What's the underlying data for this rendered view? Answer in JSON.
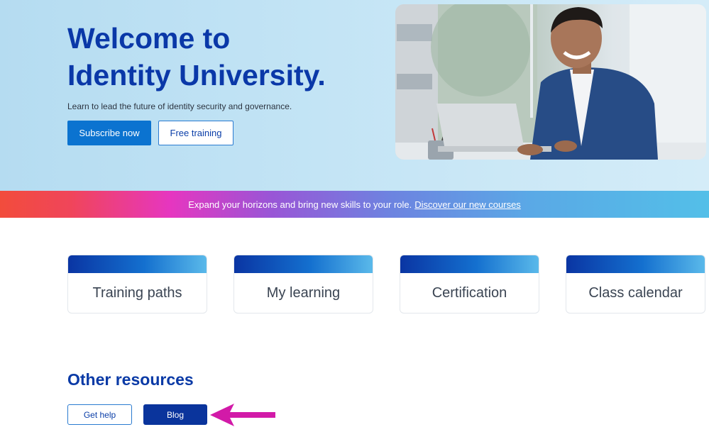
{
  "hero": {
    "title_line1": "Welcome to",
    "title_line2": "Identity University.",
    "subtitle": "Learn to lead the future of identity security and governance.",
    "subscribe_label": "Subscribe now",
    "free_training_label": "Free training",
    "photo": "smiling man in blue blazer working on laptop"
  },
  "banner": {
    "text": "Expand your horizons and bring new skills to your role.",
    "link_text": "Discover our new courses"
  },
  "cards": [
    {
      "label": "Training paths"
    },
    {
      "label": "My learning"
    },
    {
      "label": "Certification"
    },
    {
      "label": "Class calendar"
    }
  ],
  "resources": {
    "title": "Other resources",
    "get_help_label": "Get help",
    "blog_label": "Blog"
  },
  "colors": {
    "brand_blue": "#0a38a8",
    "primary_button": "#0b73d0",
    "blog_button": "#0a349c",
    "annotation_arrow": "#d21aa8"
  },
  "annotation": {
    "icon": "arrow-left-icon"
  }
}
